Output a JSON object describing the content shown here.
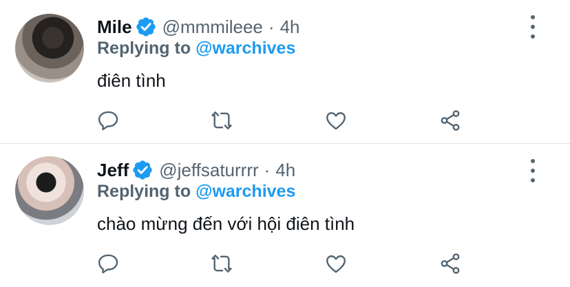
{
  "colors": {
    "verified": "#1d9bf0",
    "secondary": "#536471",
    "text": "#0f1419"
  },
  "tweets": [
    {
      "name": "Mile",
      "handle": "@mmmileee",
      "time": "4h",
      "replying_label": "Replying to",
      "replying_to": "@warchives",
      "text": "điên tình",
      "icons": [
        "verified-badge-icon",
        "more-options-icon",
        "reply-icon",
        "retweet-icon",
        "like-icon",
        "share-icon"
      ]
    },
    {
      "name": "Jeff",
      "handle": "@jeffsaturrrr",
      "time": "4h",
      "replying_label": "Replying to",
      "replying_to": "@warchives",
      "text": "chào mừng đến với hội điên tình",
      "icons": [
        "verified-badge-icon",
        "more-options-icon",
        "reply-icon",
        "retweet-icon",
        "like-icon",
        "share-icon"
      ]
    }
  ],
  "separator": "·"
}
